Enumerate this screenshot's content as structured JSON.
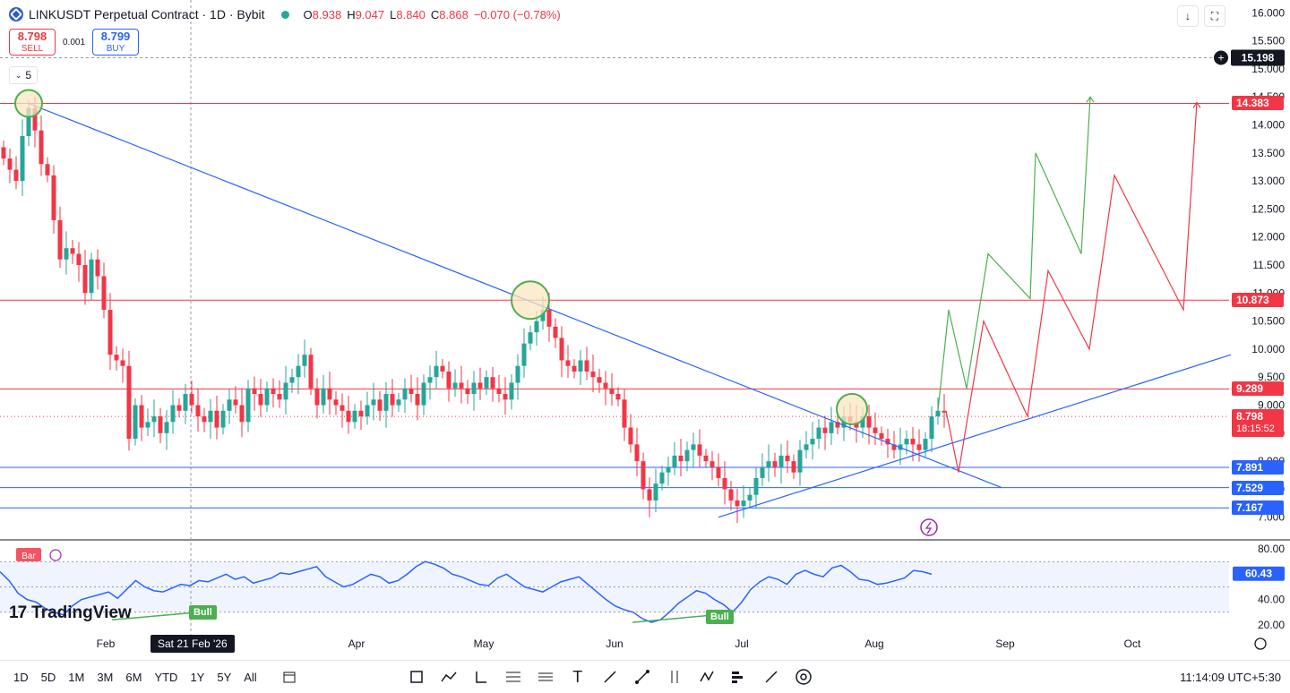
{
  "header": {
    "symbol": "LINKUSDT Perpetual Contract · 1D · Bybit",
    "ohlc": [
      {
        "k": "O",
        "v": "8.938"
      },
      {
        "k": "H",
        "v": "9.047"
      },
      {
        "k": "L",
        "v": "8.840"
      },
      {
        "k": "C",
        "v": "8.868"
      }
    ],
    "change": "−0.070 (−0.78%)"
  },
  "trade": {
    "sell_price": "8.798",
    "sell_label": "SELL",
    "spread": "0.001",
    "buy_price": "8.799",
    "buy_label": "BUY"
  },
  "indicator_count": "5",
  "crosshair": {
    "price": "15.198",
    "date": "Sat 21 Feb '26"
  },
  "price_labels": [
    {
      "value": 14.383,
      "text": "14.383",
      "color": "#f23645"
    },
    {
      "value": 10.873,
      "text": "10.873",
      "color": "#f23645"
    },
    {
      "value": 9.289,
      "text": "9.289",
      "color": "#f23645"
    },
    {
      "value": 8.798,
      "text": "8.798",
      "color": "#f23645",
      "sub": "18:15:52"
    },
    {
      "value": 7.891,
      "text": "7.891",
      "color": "#2962ff"
    },
    {
      "value": 7.529,
      "text": "7.529",
      "color": "#2962ff"
    },
    {
      "value": 7.167,
      "text": "7.167",
      "color": "#2962ff"
    }
  ],
  "rsi": {
    "label": "60.43",
    "badge": "Bull",
    "ticks": [
      "80.00",
      "60.00",
      "40.00",
      "20.00"
    ],
    "label_tag": "Bar"
  },
  "footer": {
    "timeframes": [
      "1D",
      "5D",
      "1M",
      "3M",
      "6M",
      "YTD",
      "1Y",
      "5Y",
      "All"
    ],
    "clock": "11:14:09 UTC+5:30"
  },
  "watermark": "TradingView",
  "colors": {
    "up": "#26a69a",
    "down": "#f23645",
    "trend": "#2962ff",
    "projection_green": "#4caf50",
    "projection_red": "#f23645",
    "circle_fill": "#fbe5c2",
    "circle_stroke": "#4caf50"
  },
  "chart_data": {
    "type": "candlestick",
    "y_axis_ticks": [
      "16.000",
      "15.500",
      "15.000",
      "14.500",
      "14.000",
      "13.500",
      "13.000",
      "12.500",
      "12.000",
      "11.500",
      "11.000",
      "10.500",
      "10.000",
      "9.500",
      "9.000",
      "8.500",
      "8.000",
      "7.500",
      "7.000"
    ],
    "ylim": [
      6.9,
      16.1
    ],
    "x_axis_ticks": [
      "Feb",
      "Apr",
      "May",
      "Jun",
      "Jul",
      "Aug",
      "Sep",
      "Oct"
    ],
    "horizontal_levels": [
      14.383,
      10.873,
      9.289,
      7.891,
      7.529,
      7.167
    ],
    "current_price": 8.798,
    "closes": [
      13.4,
      13.2,
      13.0,
      13.8,
      14.3,
      13.9,
      13.3,
      13.1,
      12.3,
      11.6,
      11.8,
      11.7,
      11.5,
      11.0,
      11.6,
      11.3,
      10.7,
      9.9,
      9.8,
      9.7,
      8.4,
      9.0,
      8.6,
      8.7,
      8.8,
      8.5,
      8.7,
      9.0,
      8.9,
      9.2,
      9.0,
      8.8,
      8.7,
      8.9,
      8.6,
      8.9,
      9.1,
      9.0,
      8.7,
      9.3,
      9.2,
      9.0,
      9.3,
      9.2,
      9.1,
      9.4,
      9.5,
      9.7,
      9.9,
      9.3,
      9.0,
      9.3,
      9.1,
      9.0,
      8.9,
      8.7,
      8.9,
      8.8,
      9.0,
      9.1,
      8.9,
      9.2,
      9.0,
      9.1,
      9.3,
      9.2,
      9.0,
      9.4,
      9.5,
      9.7,
      9.6,
      9.3,
      9.4,
      9.3,
      9.2,
      9.4,
      9.3,
      9.5,
      9.3,
      9.2,
      9.1,
      9.4,
      9.7,
      10.1,
      10.3,
      10.5,
      10.7,
      10.4,
      10.2,
      9.8,
      9.7,
      9.6,
      9.8,
      9.6,
      9.5,
      9.4,
      9.3,
      9.2,
      9.1,
      8.6,
      8.3,
      8.0,
      7.5,
      7.3,
      7.6,
      7.8,
      7.9,
      8.1,
      8.0,
      8.2,
      8.3,
      8.1,
      8.0,
      7.9,
      7.7,
      7.5,
      7.3,
      7.2,
      7.3,
      7.4,
      7.7,
      7.9,
      8.0,
      7.9,
      8.1,
      8.0,
      7.8,
      8.2,
      8.3,
      8.4,
      8.6,
      8.5,
      8.7,
      8.6,
      8.8,
      8.7,
      8.6,
      8.8,
      8.6,
      8.5,
      8.4,
      8.3,
      8.2,
      8.3,
      8.4,
      8.3,
      8.2,
      8.4,
      8.8,
      8.9,
      8.868
    ],
    "trendlines": [
      {
        "from": [
          "Jan",
          14.383
        ],
        "to": [
          "Sep",
          7.53
        ]
      },
      {
        "from": [
          "Jun",
          7.0
        ],
        "to": [
          "Oct",
          9.9
        ]
      }
    ],
    "projections": {
      "green": [
        8.9,
        10.7,
        9.3,
        11.7,
        10.9,
        13.5,
        11.7,
        14.5
      ],
      "red": [
        8.9,
        7.8,
        10.5,
        8.8,
        11.4,
        10.0,
        13.1,
        10.7,
        14.4
      ]
    },
    "rsi_values": [
      62,
      55,
      45,
      40,
      38,
      33,
      30,
      28,
      35,
      40,
      42,
      44,
      46,
      41,
      48,
      55,
      50,
      47,
      46,
      49,
      52,
      51,
      55,
      54,
      57,
      60,
      56,
      58,
      53,
      55,
      57,
      61,
      60,
      62,
      64,
      66,
      58,
      54,
      50,
      52,
      56,
      60,
      58,
      53,
      55,
      60,
      66,
      70,
      68,
      65,
      60,
      58,
      55,
      52,
      51,
      57,
      60,
      55,
      50,
      48,
      46,
      50,
      54,
      56,
      58,
      52,
      46,
      40,
      35,
      32,
      30,
      25,
      22,
      24,
      30,
      37,
      42,
      47,
      45,
      40,
      36,
      30,
      38,
      48,
      54,
      58,
      56,
      52,
      60,
      63,
      60,
      58,
      65,
      67,
      62,
      56,
      55,
      52,
      53,
      55,
      57,
      63,
      62,
      60
    ],
    "rsi_ylim": [
      15,
      85
    ]
  }
}
